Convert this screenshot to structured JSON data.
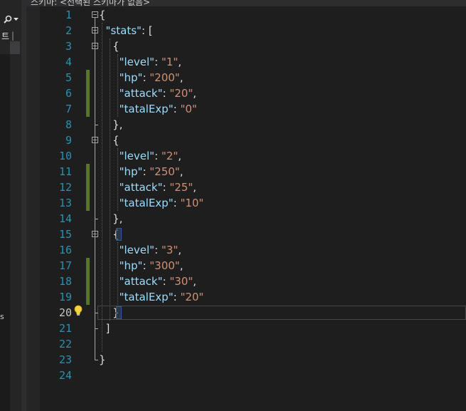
{
  "window": {
    "title": "스키마: <선택된 스키마가 없음>"
  },
  "left_panel": {
    "search_icon": "search-icon",
    "dropdown_icon": "chevron-down-icon",
    "tab_label": "트",
    "side_label": "s"
  },
  "editor": {
    "current_line": 20,
    "lines": [
      {
        "n": "1",
        "tokens": [
          [
            "p",
            "{"
          ]
        ]
      },
      {
        "n": "2",
        "tokens": [
          [
            "p",
            "  "
          ],
          [
            "k",
            "\"stats\""
          ],
          [
            "p",
            ": ["
          ]
        ]
      },
      {
        "n": "3",
        "tokens": [
          [
            "p",
            "    {"
          ]
        ]
      },
      {
        "n": "4",
        "tokens": [
          [
            "p",
            "      "
          ],
          [
            "k",
            "\"level\""
          ],
          [
            "p",
            ": "
          ],
          [
            "s",
            "\"1\""
          ],
          [
            "p",
            ","
          ]
        ]
      },
      {
        "n": "5",
        "tokens": [
          [
            "p",
            "      "
          ],
          [
            "k",
            "\"hp\""
          ],
          [
            "p",
            ": "
          ],
          [
            "s",
            "\"200\""
          ],
          [
            "p",
            ","
          ]
        ]
      },
      {
        "n": "6",
        "tokens": [
          [
            "p",
            "      "
          ],
          [
            "k",
            "\"attack\""
          ],
          [
            "p",
            ": "
          ],
          [
            "s",
            "\"20\""
          ],
          [
            "p",
            ","
          ]
        ]
      },
      {
        "n": "7",
        "tokens": [
          [
            "p",
            "      "
          ],
          [
            "k",
            "\"tatalExp\""
          ],
          [
            "p",
            ": "
          ],
          [
            "s",
            "\"0\""
          ]
        ]
      },
      {
        "n": "8",
        "tokens": [
          [
            "p",
            "    },"
          ]
        ]
      },
      {
        "n": "9",
        "tokens": [
          [
            "p",
            "    {"
          ]
        ]
      },
      {
        "n": "10",
        "tokens": [
          [
            "p",
            "      "
          ],
          [
            "k",
            "\"level\""
          ],
          [
            "p",
            ": "
          ],
          [
            "s",
            "\"2\""
          ],
          [
            "p",
            ","
          ]
        ]
      },
      {
        "n": "11",
        "tokens": [
          [
            "p",
            "      "
          ],
          [
            "k",
            "\"hp\""
          ],
          [
            "p",
            ": "
          ],
          [
            "s",
            "\"250\""
          ],
          [
            "p",
            ","
          ]
        ]
      },
      {
        "n": "12",
        "tokens": [
          [
            "p",
            "      "
          ],
          [
            "k",
            "\"attack\""
          ],
          [
            "p",
            ": "
          ],
          [
            "s",
            "\"25\""
          ],
          [
            "p",
            ","
          ]
        ]
      },
      {
        "n": "13",
        "tokens": [
          [
            "p",
            "      "
          ],
          [
            "k",
            "\"tatalExp\""
          ],
          [
            "p",
            ": "
          ],
          [
            "s",
            "\"10\""
          ]
        ]
      },
      {
        "n": "14",
        "tokens": [
          [
            "p",
            "    },"
          ]
        ]
      },
      {
        "n": "15",
        "tokens": [
          [
            "p",
            "    {"
          ]
        ]
      },
      {
        "n": "16",
        "tokens": [
          [
            "p",
            "      "
          ],
          [
            "k",
            "\"level\""
          ],
          [
            "p",
            ": "
          ],
          [
            "s",
            "\"3\""
          ],
          [
            "p",
            ","
          ]
        ]
      },
      {
        "n": "17",
        "tokens": [
          [
            "p",
            "      "
          ],
          [
            "k",
            "\"hp\""
          ],
          [
            "p",
            ": "
          ],
          [
            "s",
            "\"300\""
          ],
          [
            "p",
            ","
          ]
        ]
      },
      {
        "n": "18",
        "tokens": [
          [
            "p",
            "      "
          ],
          [
            "k",
            "\"attack\""
          ],
          [
            "p",
            ": "
          ],
          [
            "s",
            "\"30\""
          ],
          [
            "p",
            ","
          ]
        ]
      },
      {
        "n": "19",
        "tokens": [
          [
            "p",
            "      "
          ],
          [
            "k",
            "\"tatalExp\""
          ],
          [
            "p",
            ": "
          ],
          [
            "s",
            "\"20\""
          ]
        ]
      },
      {
        "n": "20",
        "tokens": [
          [
            "p",
            "    }"
          ]
        ]
      },
      {
        "n": "21",
        "tokens": [
          [
            "p",
            "  ]"
          ]
        ]
      },
      {
        "n": "22",
        "tokens": []
      },
      {
        "n": "23",
        "tokens": [
          [
            "p",
            "}"
          ]
        ]
      },
      {
        "n": "24",
        "tokens": []
      }
    ],
    "changed_lines": [
      5,
      6,
      7,
      11,
      12,
      13,
      17,
      18,
      19
    ],
    "fold_lines": [
      1,
      2,
      3,
      9,
      15
    ],
    "lightbulb_icon": "lightbulb-icon"
  },
  "colors": {
    "background": "#1e1e1e",
    "line_number": "#2b91af",
    "key": "#9cdcfe",
    "string": "#ce9178",
    "punctuation": "#dcdcdc",
    "change_marker": "#57762b"
  }
}
